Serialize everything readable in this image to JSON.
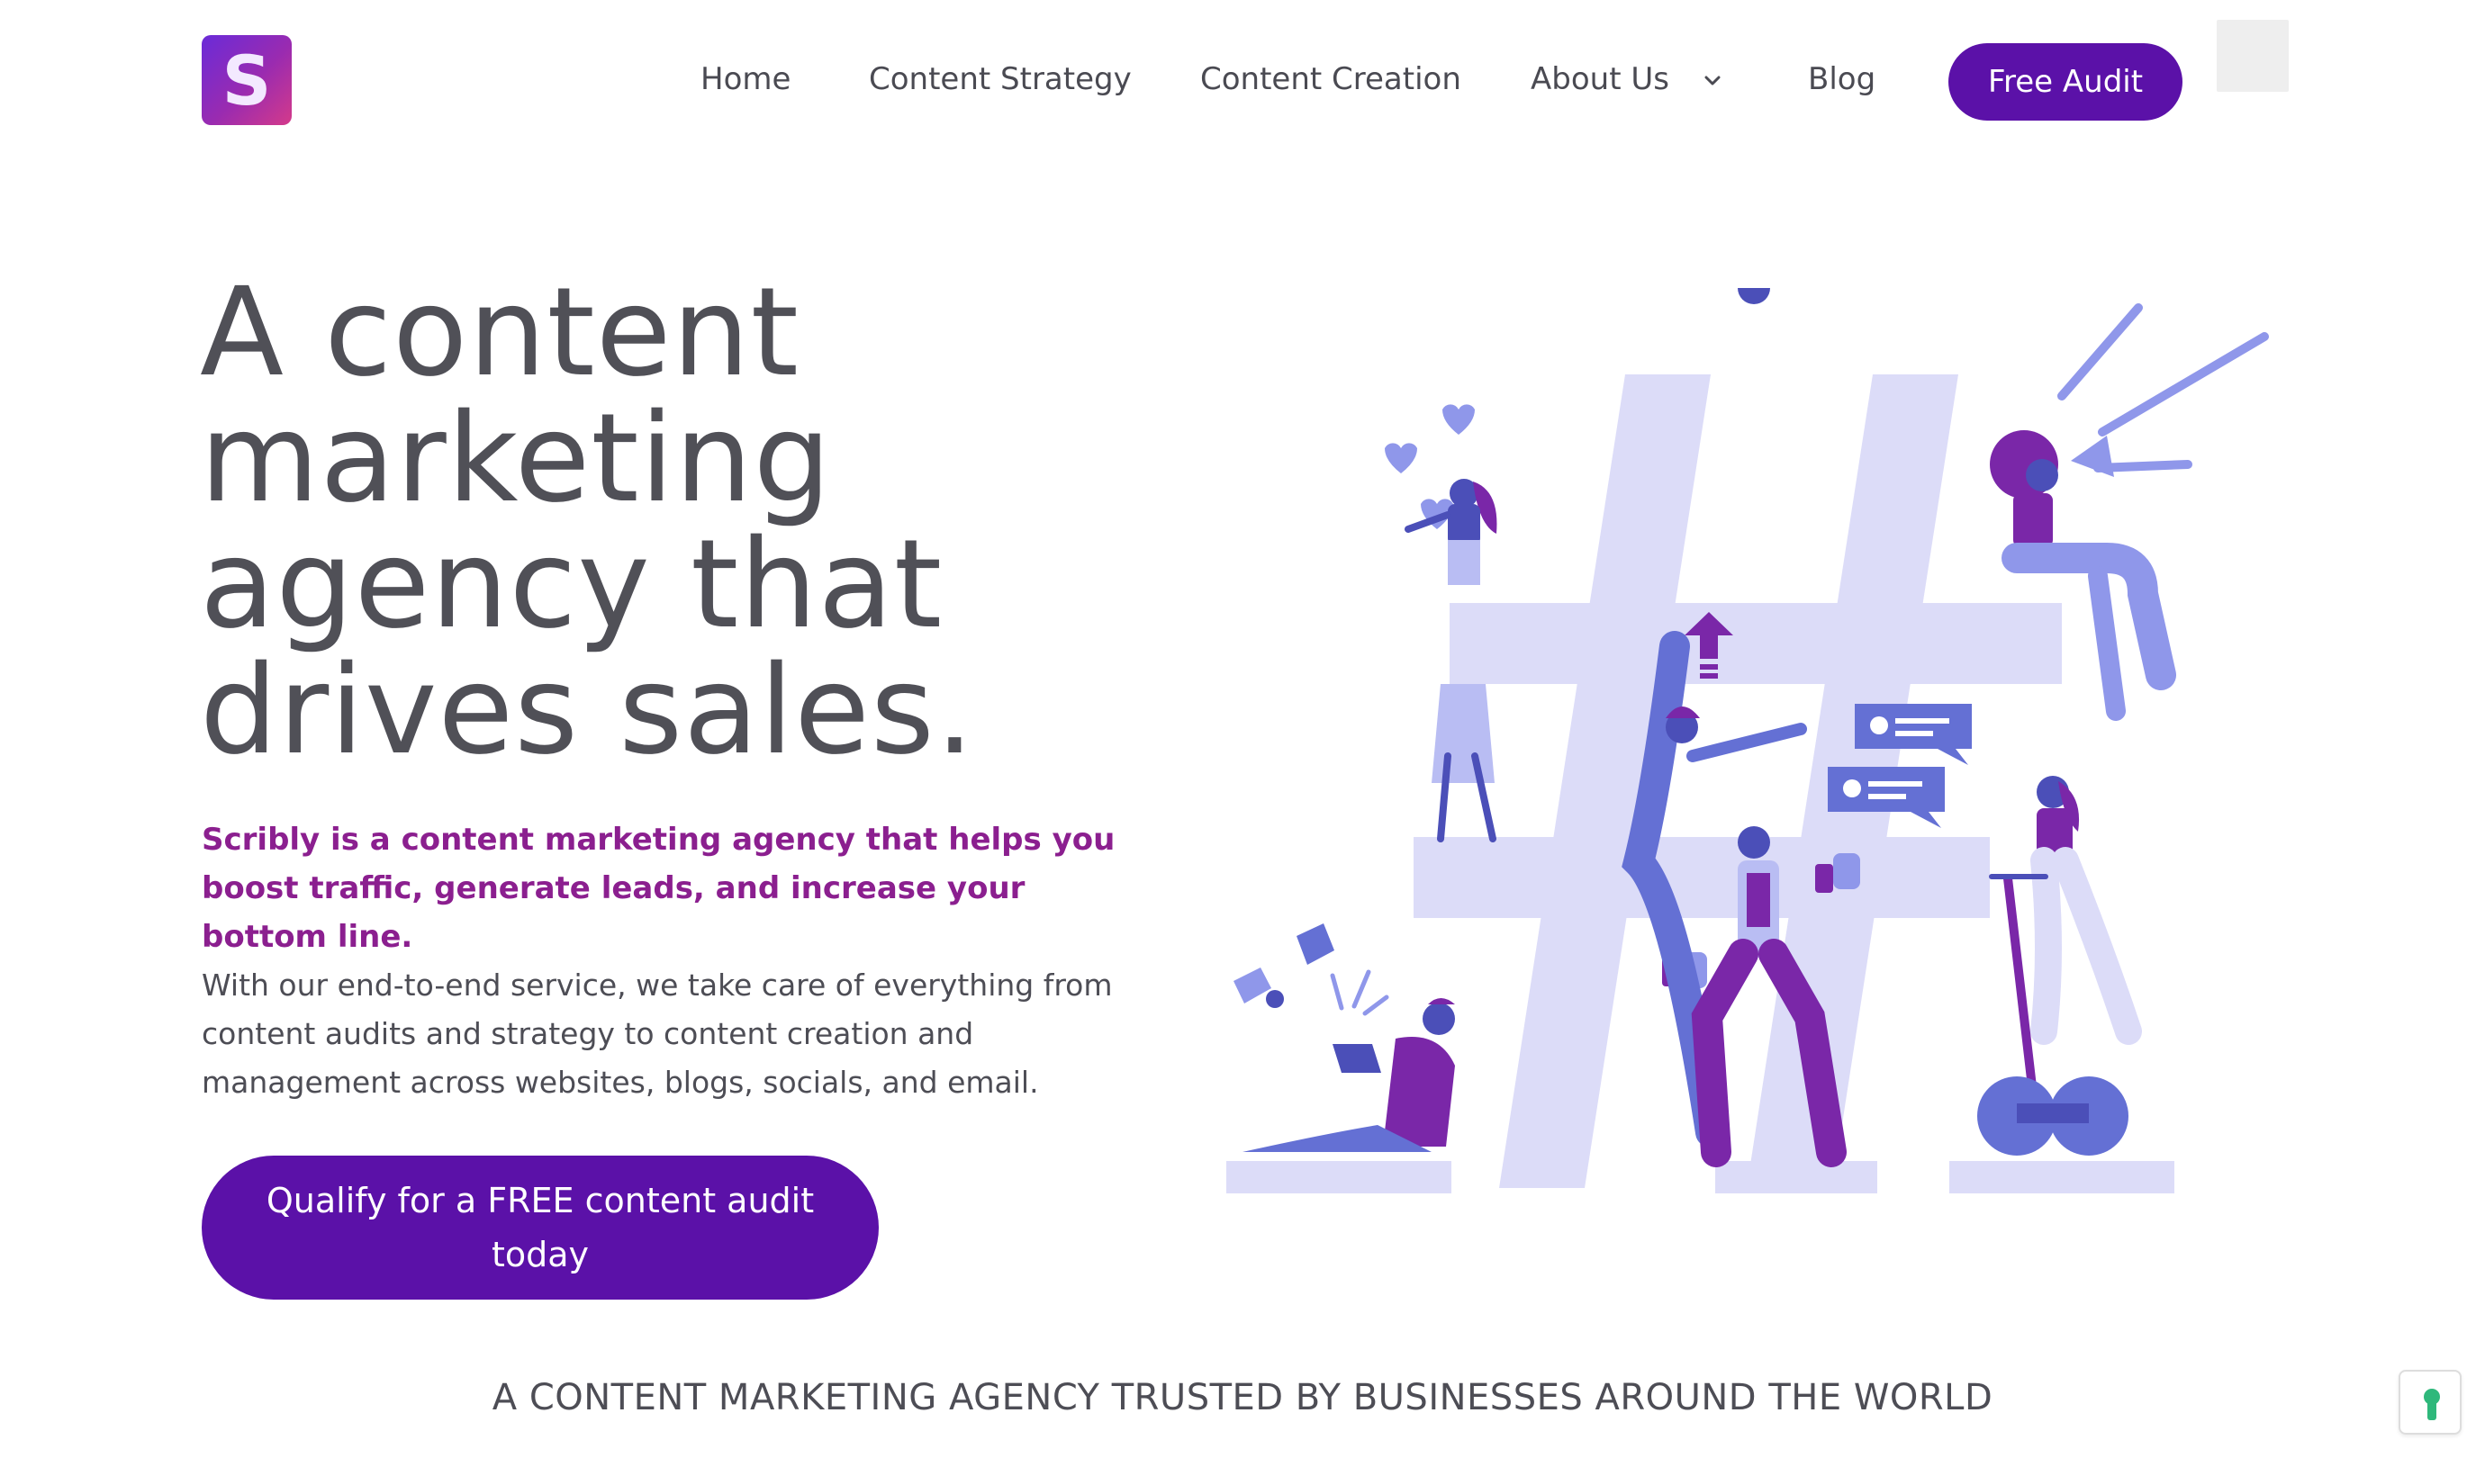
{
  "brand": {
    "logo_letter": "S",
    "accent": "#5b11a8",
    "lead_color": "#8b1f8f"
  },
  "nav": {
    "items": [
      {
        "label": "Home"
      },
      {
        "label": "Content Strategy"
      },
      {
        "label": "Content Creation"
      },
      {
        "label": "About Us",
        "has_dropdown": true
      },
      {
        "label": "Blog"
      }
    ],
    "cta": "Free Audit"
  },
  "hero": {
    "title_lines": [
      "A content",
      "marketing",
      "agency that",
      "drives sales."
    ],
    "lead": "Scribly is a content marketing agency that helps you boost traffic, generate leads, and increase your bottom line.",
    "body": "With our end-to-end service, we take care of everything from content audits and strategy to content creation and management across websites, blogs, socials, and email.",
    "cta": "Qualify for a FREE content audit today"
  },
  "trusted": "A CONTENT MARKETING AGENCY TRUSTED BY BUSINESSES AROUND THE WORLD",
  "icons": {
    "logo": "scribly-logo-icon",
    "chevron": "chevron-down-icon",
    "illustration": "hashtag-people-illustration",
    "helper": "keyhole-widget-icon"
  }
}
